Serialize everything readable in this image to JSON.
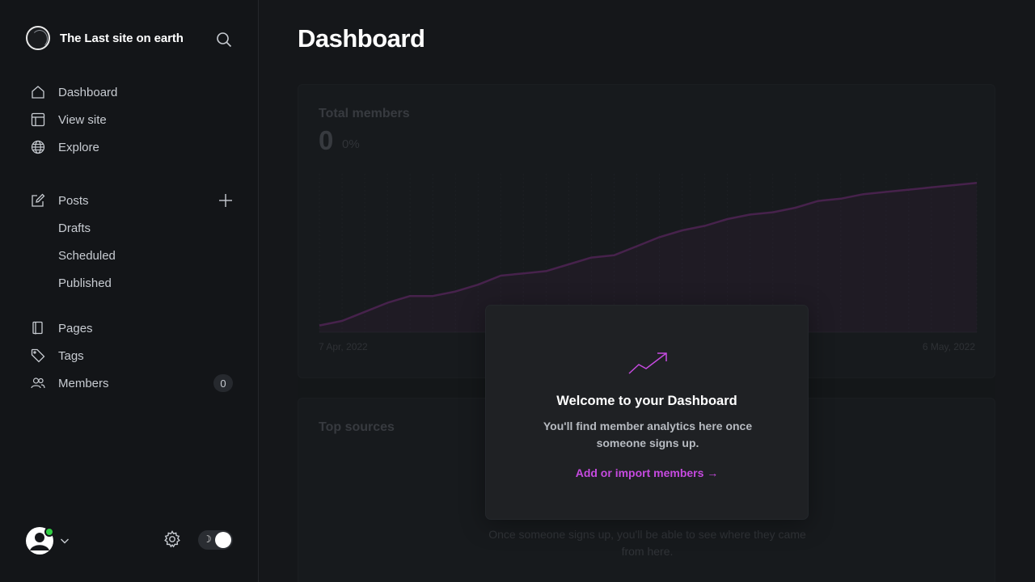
{
  "brand": {
    "site_name": "The Last site on earth"
  },
  "sidebar": {
    "primary": [
      {
        "label": "Dashboard",
        "icon": "home-icon"
      },
      {
        "label": "View site",
        "icon": "layout-icon"
      },
      {
        "label": "Explore",
        "icon": "globe-icon"
      }
    ],
    "posts": {
      "label": "Posts",
      "icon": "edit-icon",
      "sub": [
        "Drafts",
        "Scheduled",
        "Published"
      ]
    },
    "secondary": [
      {
        "label": "Pages",
        "icon": "page-icon"
      },
      {
        "label": "Tags",
        "icon": "tag-icon"
      },
      {
        "label": "Members",
        "icon": "members-icon",
        "count": "0"
      }
    ]
  },
  "page": {
    "title": "Dashboard"
  },
  "members_card": {
    "title": "Total members",
    "value": "0",
    "change": "0%",
    "x_start": "7 Apr, 2022",
    "x_end": "6 May, 2022"
  },
  "chart_data": {
    "type": "area",
    "title": "Total members",
    "x_range": [
      "7 Apr, 2022",
      "6 May, 2022"
    ],
    "series": [
      {
        "values": [
          3,
          5,
          9,
          13,
          16,
          16,
          18,
          21,
          25,
          26,
          27,
          30,
          33,
          34,
          38,
          42,
          45,
          47,
          50,
          52,
          53,
          55,
          58,
          59,
          61,
          62,
          63,
          64,
          65,
          66
        ]
      }
    ],
    "ylim": [
      0,
      70
    ],
    "grid": true,
    "accent_color": "#7a2e7f"
  },
  "sources_card": {
    "title": "Top sources",
    "empty_text": "Once someone signs up, you'll be able to see where they came from here."
  },
  "welcome": {
    "title": "Welcome to your Dashboard",
    "text": "You'll find member analytics here once someone signs up.",
    "link": "Add or import members →",
    "accent": "#c64ae0"
  },
  "footer": {
    "status": "online",
    "theme": "dark"
  }
}
